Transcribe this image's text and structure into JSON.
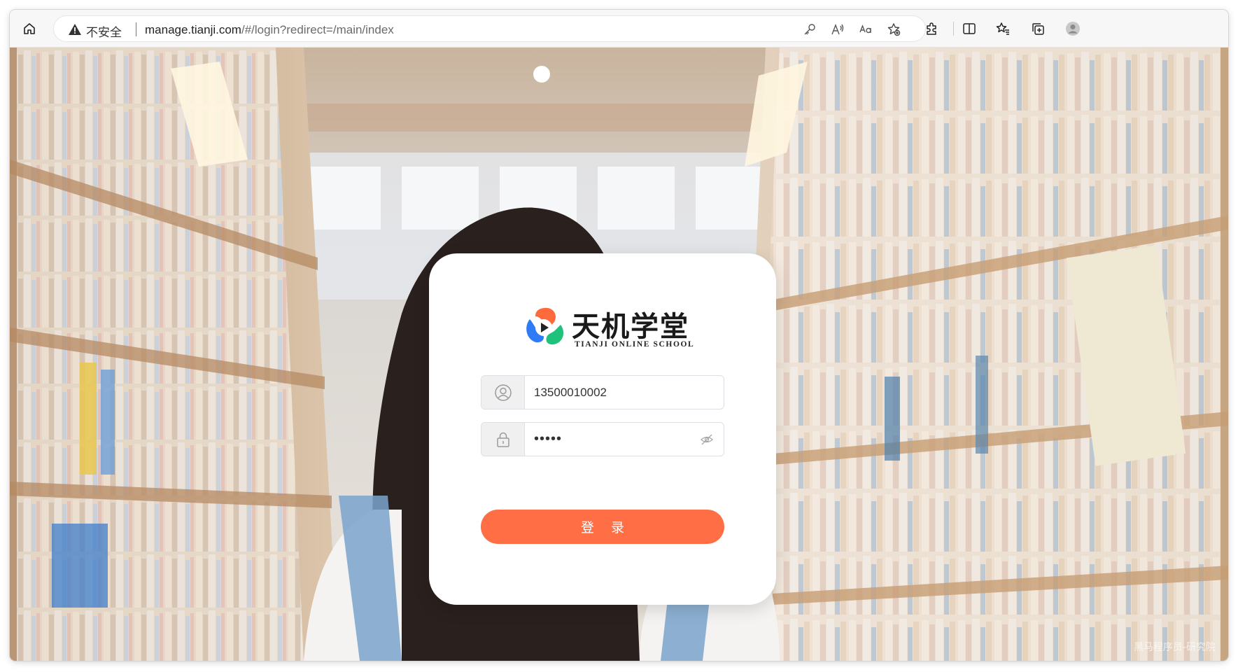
{
  "browser": {
    "security_label": "不安全",
    "url_host": "manage.tianji.com",
    "url_path": "/#/login?redirect=/main/index",
    "icons": [
      "home-icon",
      "warning-icon",
      "key-icon",
      "read-aloud-icon",
      "translate-icon",
      "add-favorite-icon",
      "extensions-icon",
      "split-screen-icon",
      "favorites-icon",
      "collections-icon",
      "profile-avatar"
    ]
  },
  "logo": {
    "name_cn": "天机学堂",
    "name_en": "TIANJI ONLINE SCHOOL"
  },
  "form": {
    "username_value": "13500010002",
    "password_value": "•••••",
    "login_label": "登 录"
  },
  "watermark": "黑马程序员-研究院",
  "colors": {
    "primary": "#ff6e45",
    "logo_orange": "#ff6a3d",
    "logo_blue": "#2f7bf5",
    "logo_green": "#1fc27a"
  }
}
